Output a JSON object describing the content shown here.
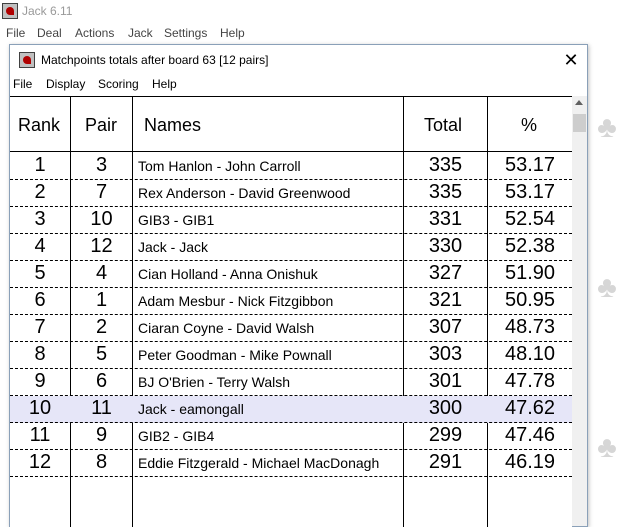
{
  "app": {
    "title": "Jack 6.11",
    "menu": [
      "File",
      "Deal",
      "Actions",
      "Jack",
      "Settings",
      "Help"
    ]
  },
  "window": {
    "title": "Matchpoints totals after board 63 [12 pairs]",
    "close": "✕",
    "menu": [
      "File",
      "Display",
      "Scoring",
      "Help"
    ]
  },
  "table": {
    "headers": {
      "rank": "Rank",
      "pair": "Pair",
      "names": "Names",
      "total": "Total",
      "pct": "%"
    },
    "rows": [
      {
        "rank": "1",
        "pair": "3",
        "names": "Tom Hanlon - John Carroll",
        "total": "335",
        "pct": "53.17"
      },
      {
        "rank": "2",
        "pair": "7",
        "names": "Rex Anderson - David Greenwood",
        "total": "335",
        "pct": "53.17"
      },
      {
        "rank": "3",
        "pair": "10",
        "names": "GIB3 - GIB1",
        "total": "331",
        "pct": "52.54"
      },
      {
        "rank": "4",
        "pair": "12",
        "names": "Jack - Jack",
        "total": "330",
        "pct": "52.38"
      },
      {
        "rank": "5",
        "pair": "4",
        "names": "Cian Holland - Anna Onishuk",
        "total": "327",
        "pct": "51.90"
      },
      {
        "rank": "6",
        "pair": "1",
        "names": "Adam Mesbur - Nick Fitzgibbon",
        "total": "321",
        "pct": "50.95"
      },
      {
        "rank": "7",
        "pair": "2",
        "names": "Ciaran Coyne - David Walsh",
        "total": "307",
        "pct": "48.73"
      },
      {
        "rank": "8",
        "pair": "5",
        "names": "Peter Goodman - Mike Pownall",
        "total": "303",
        "pct": "48.10"
      },
      {
        "rank": "9",
        "pair": "6",
        "names": "BJ O'Brien - Terry Walsh",
        "total": "301",
        "pct": "47.78"
      },
      {
        "rank": "10",
        "pair": "11",
        "names": "Jack - eamongall",
        "total": "300",
        "pct": "47.62"
      },
      {
        "rank": "11",
        "pair": "9",
        "names": "GIB2 - GIB4",
        "total": "299",
        "pct": "47.46"
      },
      {
        "rank": "12",
        "pair": "8",
        "names": "Eddie Fitzgerald - Michael MacDonagh",
        "total": "291",
        "pct": "46.19"
      }
    ],
    "highlighted_row": 9
  },
  "icons": {
    "app": "jack-app-icon",
    "window": "jack-window-icon",
    "close": "close-icon",
    "scroll_up": "scroll-up-arrow-icon",
    "background": "club-suit-icon"
  },
  "colors": {
    "highlight_row": "#e6e6f8",
    "inactive_title": "#999999"
  }
}
